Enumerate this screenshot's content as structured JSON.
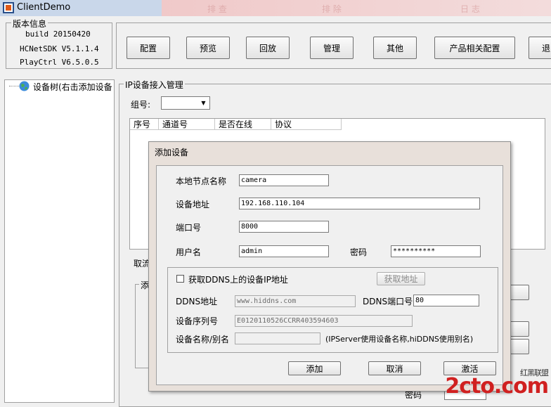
{
  "window": {
    "title": "ClientDemo",
    "faint_tabs": [
      "排 查",
      "排 除",
      "日 志"
    ]
  },
  "version_info": {
    "legend": "版本信息",
    "build": "build 20150420",
    "sdk": "HCNetSDK V5.1.1.4",
    "playctrl": "PlayCtrl V6.5.0.5"
  },
  "toolbar": [
    "配置",
    "预览",
    "回放",
    "管理",
    "其他",
    "产品相关配置",
    "退"
  ],
  "tree": {
    "root_label": "设备树(右击添加设备"
  },
  "ip_panel": {
    "legend": "IP设备接入管理",
    "group_label": "组号:",
    "columns": [
      "序号",
      "通道号",
      "是否在线",
      "协议"
    ],
    "bg_cancel_fragment": "取流",
    "bg_add_fragment": "添",
    "bg_password_label": "密码"
  },
  "dialog": {
    "title": "添加设备",
    "node_name_label": "本地节点名称",
    "node_name_value": "camera",
    "address_label": "设备地址",
    "address_value": "192.168.110.104",
    "port_label": "端口号",
    "port_value": "8000",
    "username_label": "用户名",
    "username_value": "admin",
    "password_label": "密码",
    "password_value": "**********",
    "ddns_checkbox_label": "获取DDNS上的设备IP地址",
    "get_address_button": "获取地址",
    "ddns_address_label": "DDNS地址",
    "ddns_address_value": "www.hiddns.com",
    "ddns_port_label": "DDNS端口号",
    "ddns_port_value": "80",
    "serial_label": "设备序列号",
    "serial_value": "E0120110526CCRR403594603",
    "alias_label": "设备名称/别名",
    "alias_value": "",
    "alias_hint": "(IPServer使用设备名称,hiDDNS使用别名)",
    "add_button": "添加",
    "cancel_button": "取消",
    "activate_button": "激活"
  },
  "watermark": {
    "text": "2cto.com",
    "sub": "红黑联盟"
  }
}
